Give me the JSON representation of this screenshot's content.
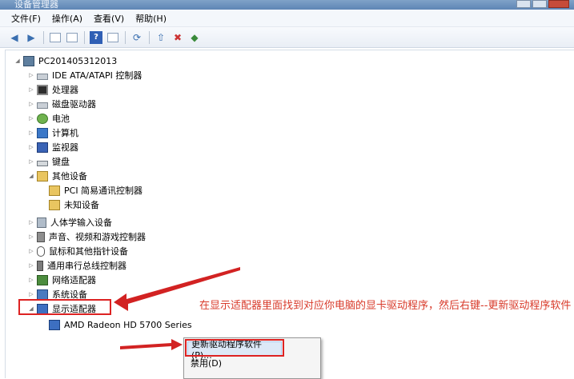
{
  "window": {
    "title": "设备管理器"
  },
  "menu": [
    "文件(F)",
    "操作(A)",
    "查看(V)",
    "帮助(H)"
  ],
  "toolbar": [
    "back-icon",
    "forward-icon",
    "properties-icon",
    "refresh-icon",
    "help-icon",
    "view-icon",
    "scan-icon",
    "update-driver-icon",
    "uninstall-icon",
    "enable-icon"
  ],
  "tree": {
    "root": "PC201405312013",
    "items": {
      "ide": "IDE ATA/ATAPI 控制器",
      "cpu": "处理器",
      "disk": "磁盘驱动器",
      "battery": "电池",
      "computer": "计算机",
      "monitor": "监视器",
      "keyboard": "键盘",
      "other": "其他设备",
      "pci": "PCI 简易通讯控制器",
      "unknown": "未知设备",
      "hid": "人体学输入设备",
      "sound": "声音、视频和游戏控制器",
      "mouse": "鼠标和其他指针设备",
      "usb": "通用串行总线控制器",
      "network": "网络适配器",
      "system": "系统设备",
      "display": "显示适配器",
      "amd": "AMD Radeon HD 5700 Series"
    }
  },
  "instruction": "在显示适配器里面找到对应你电脑的显卡驱动程序，然后右键--更新驱动程序软件",
  "context_menu": {
    "update": "更新驱动程序软件(P)...",
    "disable": "禁用(D)"
  },
  "colors": {
    "accent": "#d22222",
    "instruction": "#d83a2a"
  }
}
